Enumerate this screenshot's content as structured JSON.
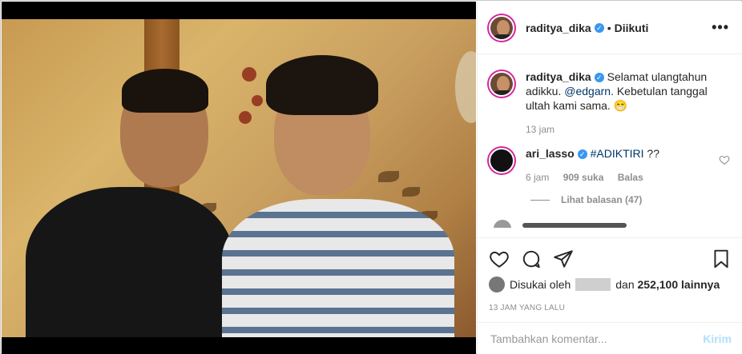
{
  "post": {
    "author": "raditya_dika",
    "follow_status": "Diikuti",
    "more_label": "•••",
    "dot": "•"
  },
  "comments": [
    {
      "username": "raditya_dika",
      "text_before": " Selamat ulangtahun adikku. ",
      "mention": "@edgarn",
      "text_after": ". Kebetulan tanggal ultah kami sama. 😁",
      "time": "13 jam"
    },
    {
      "username": "ari_lasso",
      "hashtag": "#ADIKTIRI",
      "text_after": " ??",
      "time": "6 jam",
      "likes": "909 suka",
      "reply_label": "Balas",
      "view_replies": "Lihat balasan (47)"
    }
  ],
  "likes": {
    "prefix": "Disukai oleh",
    "connector": "dan",
    "count": "252,100",
    "suffix": "lainnya"
  },
  "timestamp": "13 JAM YANG LALU",
  "add_comment": {
    "placeholder": "Tambahkan komentar...",
    "post_label": "Kirim"
  },
  "icons": {
    "verified": "verified-badge-icon",
    "like": "heart-icon",
    "comment": "comment-icon",
    "share": "share-icon",
    "save": "bookmark-icon"
  },
  "colors": {
    "verified": "#3897f0",
    "post_disabled": "#b2dffc",
    "meta": "#8e8e8e",
    "link": "#003569"
  }
}
